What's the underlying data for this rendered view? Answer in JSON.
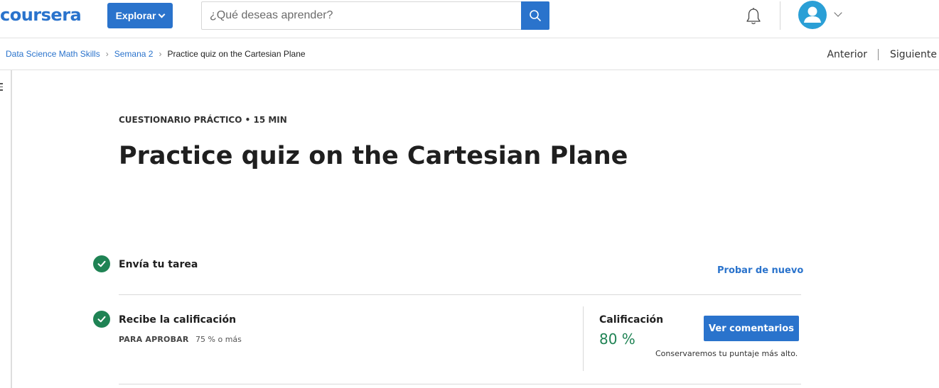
{
  "header": {
    "logo_text": "coursera",
    "explore_label": "Explorar",
    "search_placeholder": "¿Qué deseas aprender?",
    "icons": [
      "chevron-down-icon",
      "search-icon",
      "bell-icon",
      "user-avatar-icon",
      "chevron-down-icon"
    ],
    "accent_color": "#2a73cc"
  },
  "breadcrumb": {
    "items": [
      {
        "label": "Data Science Math Skills"
      },
      {
        "label": "Semana 2"
      },
      {
        "label": "Practice quiz on the Cartesian Plane"
      }
    ],
    "previous_label": "Anterior",
    "next_label": "Siguiente"
  },
  "quiz": {
    "eyebrow": "CUESTIONARIO PRÁCTICO • 15 MIN",
    "title": "Practice quiz on the Cartesian Plane",
    "steps": [
      {
        "title": "Envía tu tarea",
        "action_label": "Probar de nuevo",
        "status": "complete"
      },
      {
        "title": "Recibe la calificación",
        "status": "complete"
      }
    ],
    "pass_label": "PARA APROBAR",
    "pass_value": "75 % o más",
    "grade_label": "Calificación",
    "grade_value": "80 %",
    "feedback_button": "Ver comentarios",
    "keep_note": "Conservaremos tu puntaje más alto.",
    "success_color": "#1f8354"
  }
}
